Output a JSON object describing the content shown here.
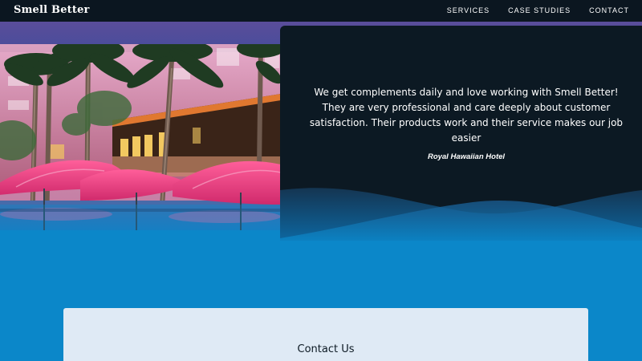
{
  "nav": {
    "brand": "Smell Better",
    "links": [
      {
        "label": "SERVICES"
      },
      {
        "label": "CASE STUDIES"
      },
      {
        "label": "CONTACT"
      }
    ]
  },
  "hero": {
    "image_icon": "hotel-pool-photo"
  },
  "testimonial": {
    "quote": "We get complements daily and love working with Smell Better! They are very professional and care deeply about customer satisfaction. Their products work and their service makes our job easier",
    "author": "Royal Hawaiian Hotel"
  },
  "contact": {
    "title": "Contact Us"
  },
  "colors": {
    "nav_bg": "#0b1620",
    "purple_band": "#5a4d9a",
    "panel_bg": "#0c1923",
    "ocean_blue": "#0b87c9",
    "card_bg": "#dfeaf5"
  }
}
